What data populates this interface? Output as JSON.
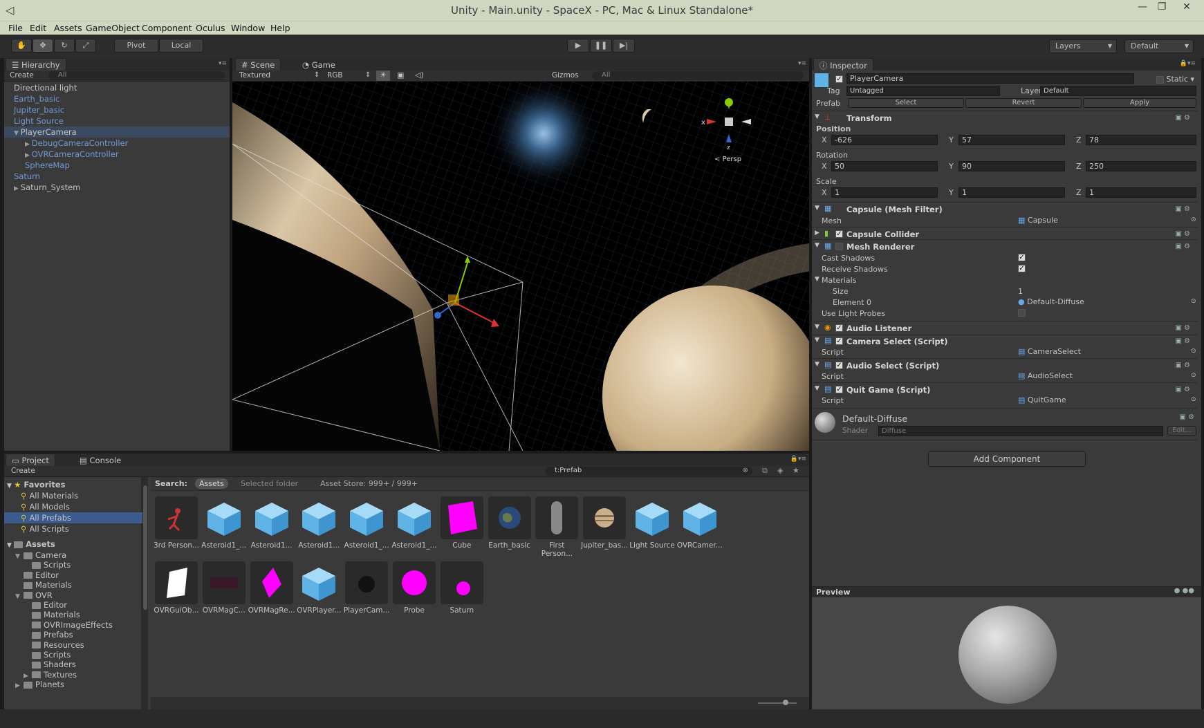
{
  "window": {
    "title": "Unity - Main.unity - SpaceX - PC, Mac & Linux Standalone*",
    "minimize": "—",
    "maximize": "❐",
    "close": "✕"
  },
  "menu": [
    "File",
    "Edit",
    "Assets",
    "GameObject",
    "Component",
    "Oculus",
    "Window",
    "Help"
  ],
  "toolbar": {
    "pivot": "Pivot",
    "local": "Local",
    "layers": "Layers",
    "layout": "Default"
  },
  "hierarchy": {
    "tab": "Hierarchy",
    "create": "Create",
    "search": "All",
    "items": [
      {
        "label": "Directional light",
        "blue": false
      },
      {
        "label": "Earth_basic",
        "blue": true
      },
      {
        "label": "Jupiter_basic",
        "blue": true
      },
      {
        "label": "Light Source",
        "blue": true
      },
      {
        "label": "PlayerCamera",
        "blue": false
      },
      {
        "label": "DebugCameraController",
        "blue": true
      },
      {
        "label": "OVRCameraController",
        "blue": true
      },
      {
        "label": "SphereMap",
        "blue": true
      },
      {
        "label": "Saturn",
        "blue": true
      },
      {
        "label": "Saturn_System",
        "blue": false
      }
    ]
  },
  "scene": {
    "tab_scene": "Scene",
    "tab_game": "Game",
    "shading": "Textured",
    "render": "RGB",
    "gizmos": "Gizmos",
    "search": "All",
    "persp": "Persp",
    "axis_x": "x",
    "axis_z": "z"
  },
  "inspector": {
    "tab": "Inspector",
    "object_name": "PlayerCamera",
    "static": "Static",
    "tag_label": "Tag",
    "tag_value": "Untagged",
    "layer_label": "Layer",
    "layer_value": "Default",
    "prefab_label": "Prefab",
    "prefab_select": "Select",
    "prefab_revert": "Revert",
    "prefab_apply": "Apply",
    "transform": {
      "title": "Transform",
      "position": "Position",
      "rotation": "Rotation",
      "scale": "Scale",
      "pos": {
        "x": "-626",
        "y": "57",
        "z": "78"
      },
      "rot": {
        "x": "50",
        "y": "90",
        "z": "250"
      },
      "scl": {
        "x": "1",
        "y": "1",
        "z": "1"
      }
    },
    "x_label": "X",
    "y_label": "Y",
    "z_label": "Z",
    "mesh_filter": {
      "title": "Capsule (Mesh Filter)",
      "mesh_label": "Mesh",
      "mesh_value": "Capsule"
    },
    "capsule_collider": {
      "title": "Capsule Collider"
    },
    "mesh_renderer": {
      "title": "Mesh Renderer",
      "cast_shadows": "Cast Shadows",
      "receive_shadows": "Receive Shadows",
      "materials": "Materials",
      "size_label": "Size",
      "size_value": "1",
      "element0_label": "Element 0",
      "element0_value": "Default-Diffuse",
      "light_probes": "Use Light Probes"
    },
    "audio_listener": {
      "title": "Audio Listener"
    },
    "camera_select": {
      "title": "Camera Select (Script)",
      "script_label": "Script",
      "script_value": "CameraSelect"
    },
    "audio_select": {
      "title": "Audio Select (Script)",
      "script_label": "Script",
      "script_value": "AudioSelect"
    },
    "quit_game": {
      "title": "Quit Game (Script)",
      "script_label": "Script",
      "script_value": "QuitGame"
    },
    "material": {
      "name": "Default-Diffuse",
      "shader_label": "Shader",
      "shader_value": "Diffuse",
      "edit": "Edit..."
    },
    "add_component": "Add Component",
    "preview": "Preview"
  },
  "project": {
    "tab_project": "Project",
    "tab_console": "Console",
    "create": "Create",
    "search": "t:Prefab",
    "search_label": "Search:",
    "scope_assets": "Assets",
    "scope_folder": "Selected folder",
    "asset_store": "Asset Store: 999+ / 999+",
    "favorites_label": "Favorites",
    "favorites": [
      "All Materials",
      "All Models",
      "All Prefabs",
      "All Scripts"
    ],
    "assets_label": "Assets",
    "tree": [
      {
        "label": "Camera",
        "indent": 1,
        "arrow": "▼"
      },
      {
        "label": "Scripts",
        "indent": 2,
        "arrow": ""
      },
      {
        "label": "Editor",
        "indent": 1,
        "arrow": ""
      },
      {
        "label": "Materials",
        "indent": 1,
        "arrow": ""
      },
      {
        "label": "OVR",
        "indent": 1,
        "arrow": "▼"
      },
      {
        "label": "Editor",
        "indent": 2,
        "arrow": ""
      },
      {
        "label": "Materials",
        "indent": 2,
        "arrow": ""
      },
      {
        "label": "OVRImageEffects",
        "indent": 2,
        "arrow": ""
      },
      {
        "label": "Prefabs",
        "indent": 2,
        "arrow": ""
      },
      {
        "label": "Resources",
        "indent": 2,
        "arrow": ""
      },
      {
        "label": "Scripts",
        "indent": 2,
        "arrow": ""
      },
      {
        "label": "Shaders",
        "indent": 2,
        "arrow": ""
      },
      {
        "label": "Textures",
        "indent": 2,
        "arrow": "▶"
      },
      {
        "label": "Planets",
        "indent": 1,
        "arrow": "▶"
      }
    ],
    "assets": [
      {
        "label": "3rd Person...",
        "kind": "figure"
      },
      {
        "label": "Asteroid1_...",
        "kind": "cube"
      },
      {
        "label": "Asteroid1...",
        "kind": "cube"
      },
      {
        "label": "Asteroid1...",
        "kind": "cube"
      },
      {
        "label": "Asteroid1_...",
        "kind": "cube"
      },
      {
        "label": "Asteroid1_...",
        "kind": "cube"
      },
      {
        "label": "Cube",
        "kind": "magenta-cube"
      },
      {
        "label": "Earth_basic",
        "kind": "earth"
      },
      {
        "label": "First Person...",
        "kind": "capsule"
      },
      {
        "label": "Jupiter_bas...",
        "kind": "jupiter"
      },
      {
        "label": "Light Source",
        "kind": "cube"
      },
      {
        "label": "OVRCamer...",
        "kind": "cube"
      },
      {
        "label": "OVRGuiOb...",
        "kind": "white-quad"
      },
      {
        "label": "OVRMagC...",
        "kind": "dark"
      },
      {
        "label": "OVRMagRe...",
        "kind": "magenta-shard"
      },
      {
        "label": "OVRPlayer...",
        "kind": "cube"
      },
      {
        "label": "PlayerCam...",
        "kind": "dark-sphere"
      },
      {
        "label": "Probe",
        "kind": "magenta-circle"
      },
      {
        "label": "Saturn",
        "kind": "magenta-dot"
      }
    ]
  },
  "colors": {
    "selection": "#3b5b8e",
    "link": "#6e9ad8",
    "magenta": "#ff00ff",
    "cube": "#5fb3e6"
  }
}
